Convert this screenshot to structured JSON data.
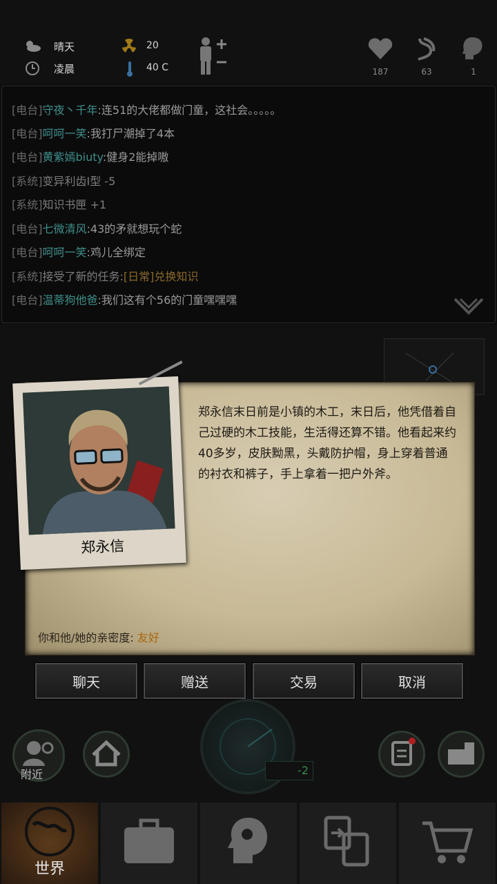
{
  "status": {
    "weather": "晴天",
    "time_of_day": "凌晨",
    "radiation": "20",
    "temperature": "40 C",
    "health": "187",
    "hunger": "63",
    "mind": "1"
  },
  "chat": {
    "lines": [
      {
        "tag": "[电台]",
        "who": "守夜丶千年",
        "msg": ":连51的大佬都做门童，这社会。。。。。"
      },
      {
        "tag": "[电台]",
        "who": "呵呵一笑",
        "msg": ":我打尸潮掉了4本"
      },
      {
        "tag": "[电台]",
        "who": "黄紫嫣biuty",
        "msg": ":健身2能掉嗷"
      },
      {
        "tag": "[系统]",
        "who": "",
        "msg": "变异利齿Ⅰ型 -5"
      },
      {
        "tag": "[系统]",
        "who": "",
        "msg": "知识书匣 +1"
      },
      {
        "tag": "[电台]",
        "who": "七微清风",
        "msg": ":43的矛就想玩个蛇"
      },
      {
        "tag": "[电台]",
        "who": "呵呵一笑",
        "msg": ":鸡儿全绑定"
      },
      {
        "tag": "[系统]",
        "who": "",
        "msg": "接受了新的任务:",
        "quest": "[日常]兑换知识"
      },
      {
        "tag": "[电台]",
        "who": "温蒂狗他爸",
        "msg": ":我们这有个56的门童嘿嘿嘿"
      }
    ]
  },
  "npc": {
    "name": "郑永信",
    "description": "郑永信末日前是小镇的木工，末日后，他凭借着自己过硬的木工技能，生活得还算不错。他看起来约40多岁，皮肤黝黑，头戴防护帽，身上穿着普通的衬衣和裤子，手上拿着一把户外斧。",
    "affinity_label": "你和他/她的亲密度:",
    "affinity_value": "友好"
  },
  "buttons": {
    "chat": "聊天",
    "gift": "赠送",
    "trade": "交易",
    "cancel": "取消"
  },
  "map": {
    "nearby": "附近",
    "radar_level": "-2"
  },
  "tabs": {
    "world": "世界"
  }
}
